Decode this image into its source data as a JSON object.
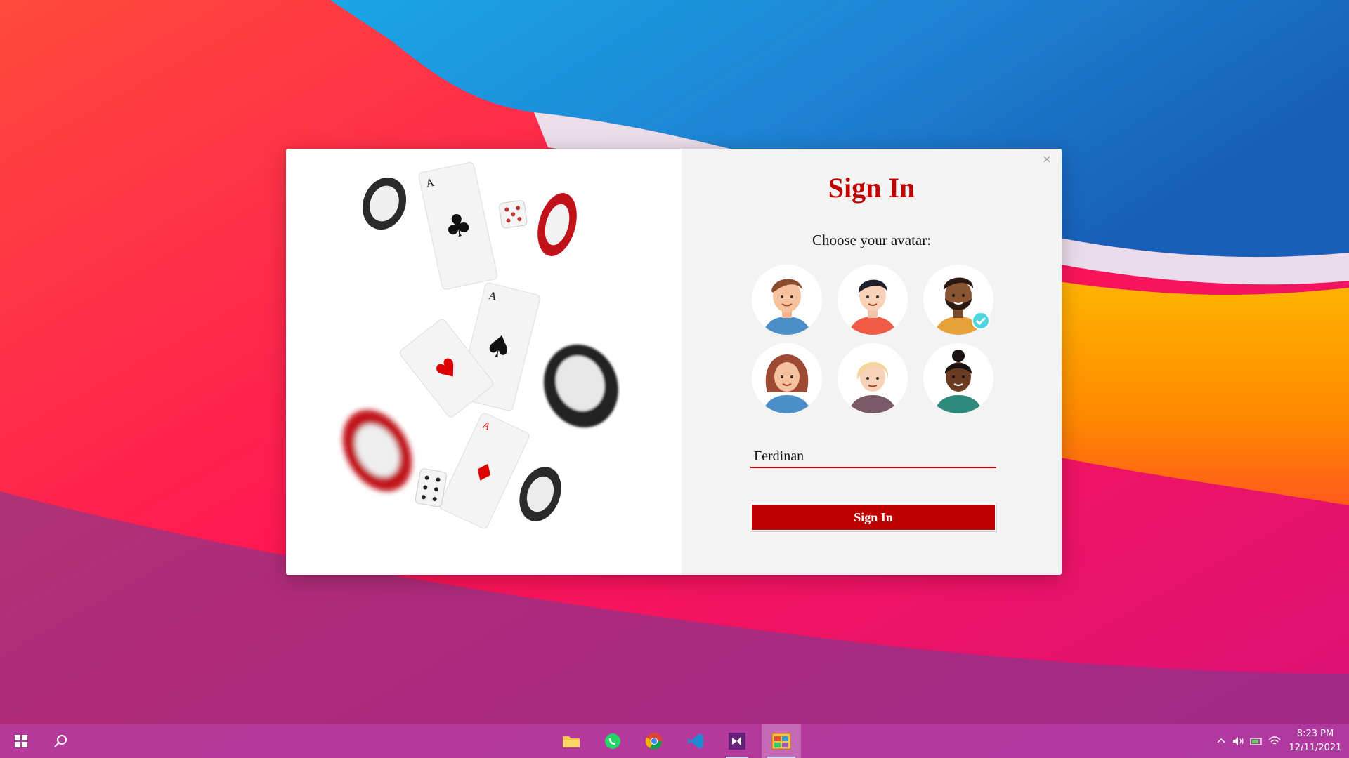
{
  "dialog": {
    "title": "Sign In",
    "avatar_prompt": "Choose your avatar:",
    "avatars": [
      {
        "name": "man-brown-hair",
        "selected": false
      },
      {
        "name": "man-black-hair",
        "selected": false
      },
      {
        "name": "man-beard",
        "selected": true
      },
      {
        "name": "woman-curly-hair",
        "selected": false
      },
      {
        "name": "woman-blonde-hair",
        "selected": false
      },
      {
        "name": "woman-bun-hair",
        "selected": false
      }
    ],
    "username_value": "Ferdinan",
    "submit_label": "Sign In",
    "close_glyph": "×"
  },
  "taskbar": {
    "apps": [
      "file-explorer",
      "whatsapp",
      "chrome",
      "vscode",
      "visual-studio",
      "card-game-app"
    ],
    "active_app": "card-game-app",
    "clock_time": "8:23 PM",
    "clock_date": "12/11/2021"
  },
  "colors": {
    "accent": "#c00000",
    "right_pane_bg": "#f3f3f3"
  }
}
